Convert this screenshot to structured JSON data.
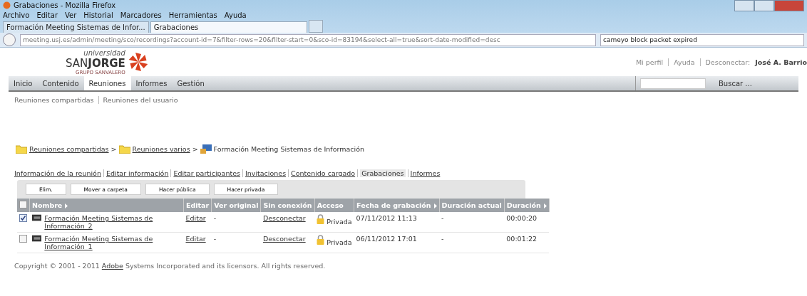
{
  "window": {
    "title": "Grabaciones - Mozilla Firefox"
  },
  "menu": [
    "Archivo",
    "Editar",
    "Ver",
    "Historial",
    "Marcadores",
    "Herramientas",
    "Ayuda"
  ],
  "tabs": [
    {
      "label": "Formación Meeting Sistemas de Infor...",
      "selected": false
    },
    {
      "label": "Grabaciones",
      "selected": true
    }
  ],
  "address": {
    "value": "meeting.usj.es/admin/meeting/sco/recordings?account-id=7&filter-rows=20&filter-start=0&sco-id=83194&select-all=true&sort-date-modified=desc"
  },
  "web_search": {
    "value": "cameyo block packet expired"
  },
  "logo": {
    "top": "universidad",
    "name_light": "SAN",
    "name_bold": "JORGE",
    "group": "GRUPO SANVALERO"
  },
  "user_links": [
    "Mi perfil",
    "Ayuda"
  ],
  "user": {
    "label": "Desconectar:",
    "name": "José A. Barrio"
  },
  "nav": [
    {
      "label": "Inicio",
      "selected": false
    },
    {
      "label": "Contenido",
      "selected": false
    },
    {
      "label": "Reuniones",
      "selected": true
    },
    {
      "label": "Informes",
      "selected": false
    },
    {
      "label": "Gestión",
      "selected": false
    }
  ],
  "search": {
    "button": "Buscar ..."
  },
  "subnav": [
    "Reuniones compartidas",
    "Reuniones del usuario"
  ],
  "breadcrumb": [
    {
      "kind": "folder",
      "label": "Reuniones compartidas"
    },
    {
      "kind": "separator",
      "label": ">"
    },
    {
      "kind": "folder",
      "label": "Reuniones varios"
    },
    {
      "kind": "separator",
      "label": ">"
    },
    {
      "kind": "meeting",
      "label": "Formación Meeting Sistemas de Información"
    }
  ],
  "meeting_links": [
    {
      "label": "Información de la reunión",
      "selected": false
    },
    {
      "label": "Editar información",
      "selected": false
    },
    {
      "label": "Editar participantes",
      "selected": false
    },
    {
      "label": "Invitaciones",
      "selected": false
    },
    {
      "label": "Contenido cargado",
      "selected": false
    },
    {
      "label": "Grabaciones",
      "selected": true
    },
    {
      "label": "Informes",
      "selected": false
    }
  ],
  "actions": [
    "Elim.",
    "Mover a carpeta",
    "Hacer pública",
    "Hacer privada"
  ],
  "table": {
    "select_all": {
      "checked": false
    },
    "columns": [
      {
        "label": "Nombre",
        "sortable": true
      },
      {
        "label": "Editar",
        "sortable": false
      },
      {
        "label": "Ver original",
        "sortable": false
      },
      {
        "label": "Sin conexión",
        "sortable": false
      },
      {
        "label": "Acceso",
        "sortable": false
      },
      {
        "label": "Fecha de grabación",
        "sortable": true
      },
      {
        "label": "Duración actual",
        "sortable": false
      },
      {
        "label": "Duración",
        "sortable": true
      }
    ],
    "rows": [
      {
        "checked": true,
        "name": "Formación Meeting Sistemas de Información_2",
        "edit": "Editar",
        "original": "-",
        "offline": "Desconectar",
        "access": "Privada",
        "date": "07/11/2012 11:13",
        "current": "-",
        "duration": "00:00:20"
      },
      {
        "checked": false,
        "name": "Formación Meeting Sistemas de Información_1",
        "edit": "Editar",
        "original": "-",
        "offline": "Desconectar",
        "access": "Privada",
        "date": "06/11/2012 17:01",
        "current": "-",
        "duration": "00:01:22"
      }
    ]
  },
  "footer": {
    "before": "Copyright © 2001 - 2011",
    "link": "Adobe",
    "after": "Systems Incorporated and its licensors. All rights reserved."
  }
}
